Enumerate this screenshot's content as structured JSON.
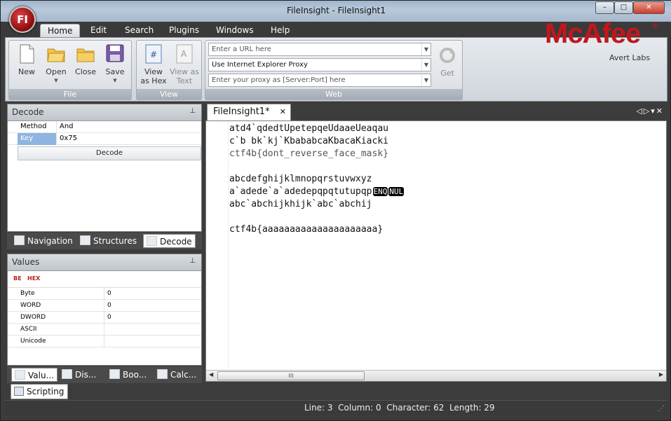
{
  "window": {
    "title": "FileInsight - FileInsight1",
    "app_orb": "FI",
    "controls": {
      "minimize": "–",
      "maximize": "□",
      "close": "✕"
    }
  },
  "ribbon": {
    "tabs": [
      {
        "label": "Home",
        "active": true
      },
      {
        "label": "Edit",
        "active": false
      },
      {
        "label": "Search",
        "active": false
      },
      {
        "label": "Plugins",
        "active": false
      },
      {
        "label": "Windows",
        "active": false
      },
      {
        "label": "Help",
        "active": false
      }
    ],
    "file_group": {
      "label": "File",
      "new": "New",
      "open": "Open",
      "close": "Close",
      "save": "Save"
    },
    "view_group": {
      "label": "View",
      "view_hex_line1": "View",
      "view_hex_line2": "as Hex",
      "view_text_line1": "View as",
      "view_text_line2": "Text"
    },
    "web_group": {
      "label": "Web",
      "url_placeholder": "Enter a URL here",
      "proxy_mode": "Use Internet Explorer Proxy",
      "proxy_placeholder": "Enter your proxy as [Server:Port] here",
      "get": "Get"
    }
  },
  "logo": {
    "main": "McAfee",
    "registered": "®",
    "sub": "Avert Labs"
  },
  "decode_pane": {
    "title": "Decode",
    "pin": "📌",
    "rows": [
      {
        "key": "Method",
        "value": "And"
      },
      {
        "key": "Key",
        "value": "0x75"
      }
    ],
    "decode_button": "Decode"
  },
  "left_tabs": [
    {
      "label": "Navigation",
      "active": false
    },
    {
      "label": "Structures",
      "active": false
    },
    {
      "label": "Decode",
      "active": true
    }
  ],
  "values_pane": {
    "title": "Values",
    "be_label": "BE",
    "hex_label": "HEX",
    "rows": [
      {
        "key": "Byte",
        "value": "0"
      },
      {
        "key": "WORD",
        "value": "0"
      },
      {
        "key": "DWORD",
        "value": "0"
      },
      {
        "key": "ASCII",
        "value": ""
      },
      {
        "key": "Unicode",
        "value": ""
      }
    ]
  },
  "bottom_tabs": [
    {
      "label": "Valu...",
      "active": true
    },
    {
      "label": "Dis...",
      "active": false
    },
    {
      "label": "Boo...",
      "active": false
    },
    {
      "label": "Calc...",
      "active": false
    }
  ],
  "scripting_tab": "Scripting",
  "editor": {
    "tab_label": "FileInsight1*",
    "lines": [
      "atd4`qdedtUpetepqeUdaaeUeaqau",
      "c`b bk`kj`KbababcaKbacaKiacki",
      "ctf4b{dont_reverse_face_mask}",
      "",
      "abcdefghijklmnopqrstuvwxyz",
      "a`adede`a`adedepqpqtutupqp",
      "abc`abchijkhijk`abc`abchij",
      "",
      "ctf4b{aaaaaaaaaaaaaaaaaaaaa}"
    ],
    "control_chars": [
      "ENQ",
      "NUL"
    ],
    "scroll_thumb": "III"
  },
  "status": {
    "line": "Line: 3",
    "column": "Column: 0",
    "character": "Character: 62",
    "length": "Length: 29"
  }
}
